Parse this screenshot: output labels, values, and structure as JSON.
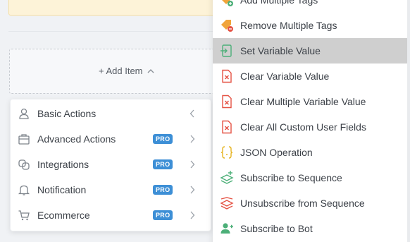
{
  "builder": {
    "add_item_label": "+ Add Item"
  },
  "categories": [
    {
      "label": "Basic Actions",
      "pro": "",
      "icon": "person-icon"
    },
    {
      "label": "Advanced Actions",
      "pro": "PRO",
      "icon": "briefcase-icon"
    },
    {
      "label": "Integrations",
      "pro": "PRO",
      "icon": "link-icon"
    },
    {
      "label": "Notification",
      "pro": "PRO",
      "icon": "bell-icon"
    },
    {
      "label": "Ecommerce",
      "pro": "PRO",
      "icon": "cart-icon"
    }
  ],
  "actions": [
    {
      "label": "Add Multiple Tags",
      "icon": "tag-add-icon"
    },
    {
      "label": "Remove Multiple Tags",
      "icon": "tag-remove-icon"
    },
    {
      "label": "Set Variable Value",
      "icon": "set-variable-icon"
    },
    {
      "label": "Clear Variable Value",
      "icon": "clear-file-icon"
    },
    {
      "label": "Clear Multiple Variable Value",
      "icon": "clear-file-icon"
    },
    {
      "label": "Clear All Custom User Fields",
      "icon": "clear-file-icon"
    },
    {
      "label": "JSON Operation",
      "icon": "json-braces-icon"
    },
    {
      "label": "Subscribe to Sequence",
      "icon": "subscribe-sequence-icon"
    },
    {
      "label": "Unsubscribe from Sequence",
      "icon": "unsubscribe-sequence-icon"
    },
    {
      "label": "Subscribe to Bot",
      "icon": "user-add-icon"
    }
  ],
  "colors": {
    "pro_badge": "#3d8fd6",
    "active_row": "#cfcfcf",
    "tag_orange": "#f0a43a",
    "clear_red": "#e55244",
    "green": "#4caf78",
    "json_yellow": "#e6b422"
  }
}
